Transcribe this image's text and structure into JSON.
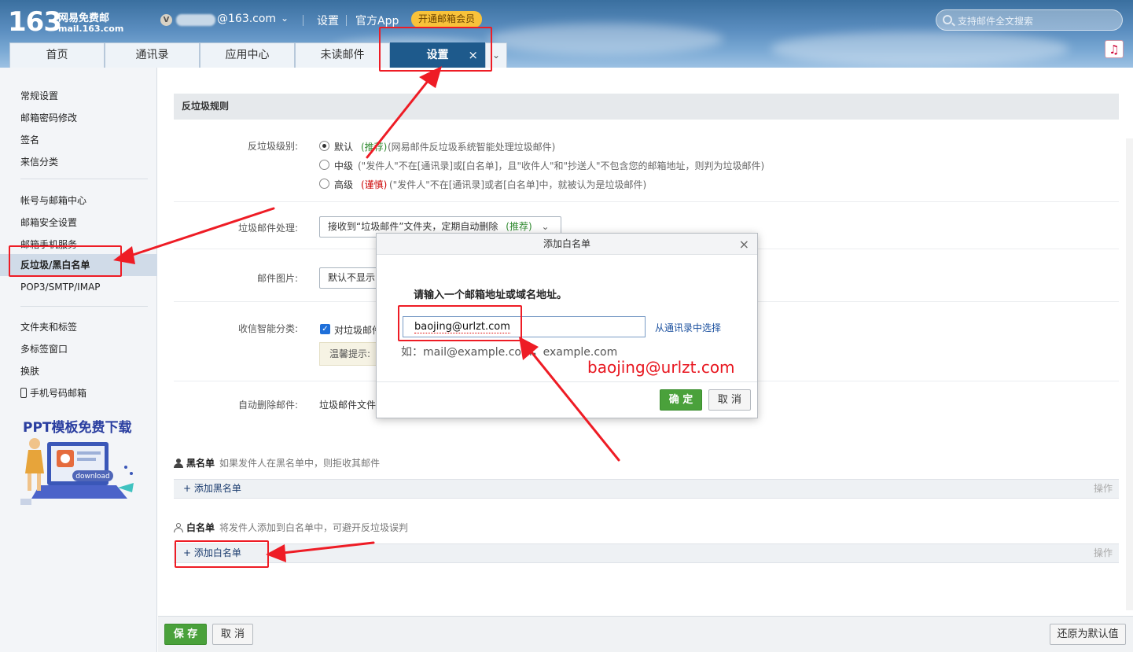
{
  "header": {
    "logo_number": "163",
    "logo_name": "网易免费邮",
    "logo_url": "mail.163.com",
    "user_badge": "V",
    "user_email_suffix": "@163.com",
    "links": [
      "设置",
      "官方App"
    ],
    "vip_label": "开通邮箱会员",
    "search_placeholder": "支持邮件全文搜索",
    "music_icon": "♫"
  },
  "tabs": [
    {
      "label": "首页"
    },
    {
      "label": "通讯录"
    },
    {
      "label": "应用中心"
    },
    {
      "label": "未读邮件"
    },
    {
      "label": "设置",
      "active": true,
      "close": "×"
    }
  ],
  "tab_more": "⌄",
  "sidebar": {
    "group1": [
      "常规设置",
      "邮箱密码修改",
      "签名",
      "来信分类"
    ],
    "group2": [
      "帐号与邮箱中心",
      "邮箱安全设置",
      "邮箱手机服务",
      "反垃圾/黑白名单",
      "POP3/SMTP/IMAP"
    ],
    "group3": [
      "文件夹和标签",
      "多标签窗口",
      "换肤",
      "手机号码邮箱"
    ],
    "ad_title": "PPT模板免费下载",
    "ad_download": "download"
  },
  "main": {
    "section_title": "反垃圾规则",
    "spam_level_label": "反垃圾级别:",
    "levels": [
      {
        "name": "默认",
        "tag": "(推荐)",
        "desc": "(网易邮件反垃圾系统智能处理垃圾邮件)",
        "selected": true
      },
      {
        "name": "中级",
        "tag": "",
        "desc": "(\"发件人\"不在[通讯录]或[白名单]，且\"收件人\"和\"抄送人\"不包含您的邮箱地址，则判为垃圾邮件)"
      },
      {
        "name": "高级",
        "tag": "(谨慎)",
        "desc": "(\"发件人\"不在[通讯录]或者[白名单]中，就被认为是垃圾邮件)"
      }
    ],
    "junk_handling_label": "垃圾邮件处理:",
    "junk_handling_value": "接收到“垃圾邮件”文件夹，定期自动删除",
    "junk_handling_tag": "(推荐)",
    "images_label": "邮件图片:",
    "images_value": "默认不显示",
    "smart_label": "收信智能分类:",
    "smart_check": "对垃圾邮件",
    "smart_tip": "温馨提示:",
    "auto_delete_label": "自动删除邮件:",
    "auto_delete_value": "垃圾邮件文件",
    "blacklist_title": "黑名单",
    "blacklist_desc": "如果发件人在黑名单中，则拒收其邮件",
    "blacklist_add": "+ 添加黑名单",
    "whitelist_title": "白名单",
    "whitelist_desc": "将发件人添加到白名单中，可避开反垃圾误判",
    "whitelist_add": "+ 添加白名单",
    "op_label": "操作",
    "save": "保 存",
    "cancel": "取 消",
    "restore": "还原为默认值"
  },
  "dialog": {
    "title": "添加白名单",
    "close": "×",
    "prompt": "请输入一个邮箱地址或域名地址。",
    "input_value": "baojing@urlzt.com",
    "from_contacts": "从通讯录中选择",
    "example": "如：mail@example.com，example.com",
    "ok": "确 定",
    "cancel": "取 消"
  },
  "annotation_text": "baojing@urlzt.com",
  "colors": {
    "header_blue": "#3a6f9f",
    "active_tab": "#1e5a8c",
    "annotation_red": "#ee1c25",
    "ok_green": "#4aa13b"
  }
}
